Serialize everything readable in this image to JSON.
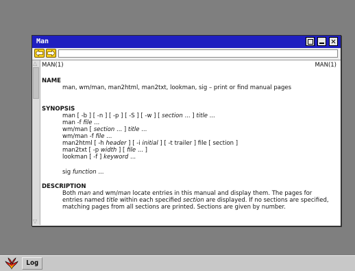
{
  "window": {
    "title": "Man",
    "close_glyph": "✕"
  },
  "toolbar": {
    "back_icon": "back-arrow-icon",
    "forward_icon": "forward-arrow-icon",
    "address_value": ""
  },
  "page": {
    "header_left": "MAN(1)",
    "header_right": "MAN(1)",
    "name_heading": "NAME",
    "name_body": "man, wm/man, man2html, man2txt, lookman, sig – print or find manual pages",
    "synopsis_heading": "SYNOPSIS",
    "synopsis_lines": [
      {
        "pre": "man [ -b ] [ -n ] [ -p ] [ -S ] [ -w ] [ ",
        "it1": "section",
        "mid": " ... ] ",
        "it2": "title",
        "post": " ..."
      },
      {
        "pre": "man -f ",
        "it1": "file",
        "mid": " ...",
        "it2": "",
        "post": ""
      },
      {
        "pre": "wm/man [ ",
        "it1": "section",
        "mid": " ... ] ",
        "it2": "title",
        "post": " ..."
      },
      {
        "pre": "wm/man -f ",
        "it1": "file",
        "mid": " ...",
        "it2": "",
        "post": ""
      },
      {
        "pre": "man2html [ -h ",
        "it1": "header",
        "mid": " ] [ -i ",
        "it2": "initial",
        "post": " ] [ -t trailer ] file [ section ]"
      },
      {
        "pre": "man2txt [ -p ",
        "it1": "width",
        "mid": " ] [ ",
        "it2": "file",
        "post": " ... ]"
      },
      {
        "pre": "lookman [ -f ] ",
        "it1": "keyword",
        "mid": " ...",
        "it2": "",
        "post": ""
      },
      {
        "pre": "sig ",
        "it1": "function",
        "mid": " ...",
        "it2": "",
        "post": ""
      }
    ],
    "description_heading": "DESCRIPTION",
    "description_body": {
      "a": "Both ",
      "b": "man",
      "c": " and wm/",
      "d": "man",
      "e": " locate entries in this manual and display them. The pages for entries named ",
      "f": "title",
      "g": " within each specified ",
      "h": "section",
      "i": " are displayed. If no sections are specified, matching pages from all sections are printed. Sections are given by number."
    }
  },
  "taskbar": {
    "logo_icon": "inferno-logo-icon",
    "task_label": "Log"
  },
  "colors": {
    "titlebar": "#1f1fc0",
    "desktop": "#7f7f7f",
    "taskbar": "#c8c8c8",
    "arrow_button": "#f5d020"
  }
}
